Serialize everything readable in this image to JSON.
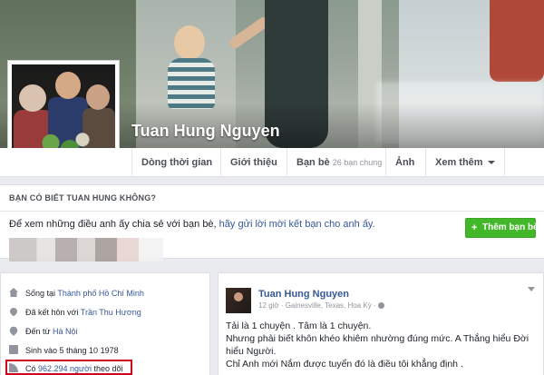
{
  "profile": {
    "name": "Tuan Hung Nguyen"
  },
  "nav": {
    "timeline": "Dòng thời gian",
    "about": "Giới thiệu",
    "friends": "Bạn bè",
    "friends_count": "26 bạn chung",
    "photos": "Ảnh",
    "more": "Xem thêm"
  },
  "know_card": {
    "heading": "BẠN CÓ BIẾT TUAN HUNG KHÔNG?",
    "text_before": "Để xem những điều anh ấy chia sẻ với bạn bè, ",
    "link": "hãy gửi lời mời kết bạn cho anh ấy.",
    "add_friend_icon": "+",
    "add_friend_label": "Thêm bạn bè"
  },
  "intro": {
    "lives_prefix": "Sống tại ",
    "lives_place": "Thành phố Hồ Chí Minh",
    "married_prefix": "Đã kết hôn với ",
    "married_to": "Trần Thu Hương",
    "from_prefix": "Đến từ ",
    "from_place": "Hà Nội",
    "born": "Sinh vào 5 tháng 10 1978",
    "followers_prefix": "Có ",
    "followers_count": "962.294 người",
    "followers_suffix": " theo dõi"
  },
  "post": {
    "author": "Tuan Hung Nguyen",
    "meta": "12 giờ · Gainesville, Texas, Hoa Kỳ · ",
    "line1": "Tải là 1 chuyện . Tâm là 1 chuyện.",
    "line2": "Nhưng phải biết khôn khéo khiêm nhường đúng mức. A Thắng hiểu Đời hiểu Người.",
    "line3": "Chỉ Anh mới Nắm được tuyển đó là điều tôi khẳng định ."
  },
  "colors": {
    "link": "#365899",
    "add_friend": "#42b72a",
    "highlight": "#d0021b"
  }
}
